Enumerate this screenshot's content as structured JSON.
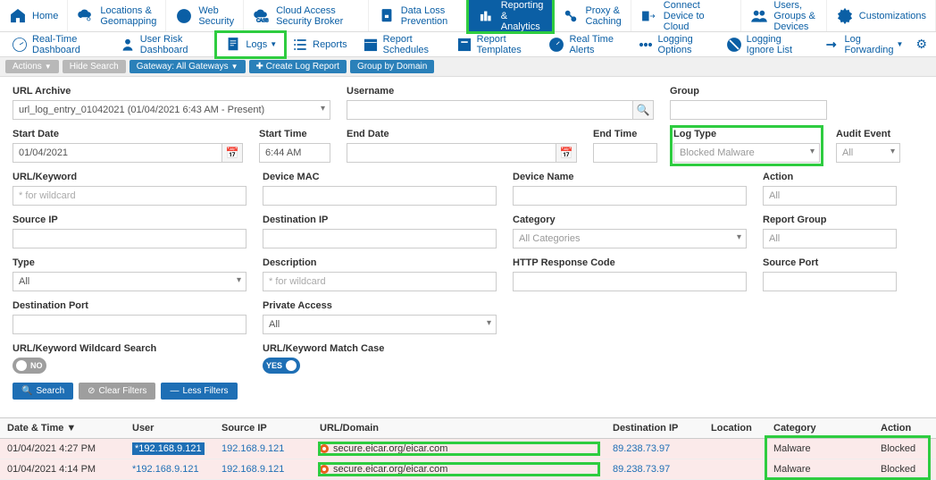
{
  "topnav": [
    {
      "label": "Home",
      "icon": "home"
    },
    {
      "label": "Locations & Geomapping",
      "icon": "cloud-pin"
    },
    {
      "label": "Web Security",
      "icon": "globe"
    },
    {
      "label": "Cloud Access Security Broker",
      "icon": "casb"
    },
    {
      "label": "Data Loss Prevention",
      "icon": "lock-doc"
    },
    {
      "label": "Reporting & Analytics",
      "icon": "bars",
      "active": true
    },
    {
      "label": "Proxy & Caching",
      "icon": "proxy"
    },
    {
      "label": "Connect Device to Cloud",
      "icon": "connect"
    },
    {
      "label": "Users, Groups & Devices",
      "icon": "users"
    },
    {
      "label": "Customizations",
      "icon": "gear"
    }
  ],
  "subnav": {
    "items": [
      {
        "label": "Real-Time Dashboard",
        "icon": "gauge"
      },
      {
        "label": "User Risk Dashboard",
        "icon": "userrisk"
      },
      {
        "label": "Logs",
        "icon": "doc",
        "highlight": true,
        "caret": true
      },
      {
        "label": "Reports",
        "icon": "list"
      },
      {
        "label": "Report Schedules",
        "icon": "calendar"
      },
      {
        "label": "Report Templates",
        "icon": "template"
      },
      {
        "label": "Real Time Alerts",
        "icon": "alert"
      },
      {
        "label": "Logging Options",
        "icon": "options"
      },
      {
        "label": "Logging Ignore List",
        "icon": "ignore"
      },
      {
        "label": "Log Forwarding",
        "icon": "forward",
        "caret": true
      }
    ]
  },
  "toolbar": [
    {
      "label": "Actions",
      "blue": false,
      "caret": true
    },
    {
      "label": "Hide Search",
      "blue": false
    },
    {
      "label": "Gateway: All Gateways",
      "blue": true,
      "caret": true
    },
    {
      "label": "Create Log Report",
      "blue": true,
      "icon": "plus"
    },
    {
      "label": "Group by Domain",
      "blue": true
    }
  ],
  "filters": {
    "urlarchive": {
      "label": "URL Archive",
      "value": "url_log_entry_01042021 (01/04/2021 6:43 AM - Present)"
    },
    "username": {
      "label": "Username"
    },
    "group": {
      "label": "Group"
    },
    "startdate": {
      "label": "Start Date",
      "value": "01/04/2021"
    },
    "starttime": {
      "label": "Start Time",
      "value": "6:44 AM"
    },
    "enddate": {
      "label": "End Date"
    },
    "endtime": {
      "label": "End Time"
    },
    "logtype": {
      "label": "Log Type",
      "value": "Blocked Malware"
    },
    "auditevent": {
      "label": "Audit Event",
      "value": "All"
    },
    "urlkeyword": {
      "label": "URL/Keyword",
      "placeholder": "* for wildcard"
    },
    "devicemac": {
      "label": "Device MAC"
    },
    "devicename": {
      "label": "Device Name"
    },
    "action": {
      "label": "Action",
      "value": "All"
    },
    "sourceip": {
      "label": "Source IP"
    },
    "destip": {
      "label": "Destination IP"
    },
    "category": {
      "label": "Category",
      "value": "All Categories"
    },
    "reportgroup": {
      "label": "Report Group",
      "value": "All"
    },
    "type": {
      "label": "Type",
      "value": "All"
    },
    "description": {
      "label": "Description",
      "placeholder": "* for wildcard"
    },
    "httpresp": {
      "label": "HTTP Response Code"
    },
    "sourceport": {
      "label": "Source Port"
    },
    "destport": {
      "label": "Destination Port"
    },
    "privateaccess": {
      "label": "Private Access",
      "value": "All"
    },
    "wildcard": {
      "label": "URL/Keyword Wildcard Search",
      "value": "NO"
    },
    "matchcase": {
      "label": "URL/Keyword Match Case",
      "value": "YES"
    }
  },
  "buttons": {
    "search": "Search",
    "clear": "Clear Filters",
    "less": "Less Filters"
  },
  "table": {
    "headers": [
      "Date & Time",
      "User",
      "Source IP",
      "URL/Domain",
      "Destination IP",
      "Location",
      "Category",
      "Action"
    ],
    "rows": [
      {
        "dt": "01/04/2021 4:27 PM",
        "user": "*192.168.9.121",
        "userhl": true,
        "src": "192.168.9.121",
        "url": "secure.eicar.org/eicar.com",
        "dst": "89.238.73.97",
        "loc": "",
        "cat": "Malware",
        "act": "Blocked"
      },
      {
        "dt": "01/04/2021 4:14 PM",
        "user": "*192.168.9.121",
        "src": "192.168.9.121",
        "url": "secure.eicar.org/eicar.com",
        "dst": "89.238.73.97",
        "loc": "",
        "cat": "Malware",
        "act": "Blocked"
      }
    ]
  }
}
